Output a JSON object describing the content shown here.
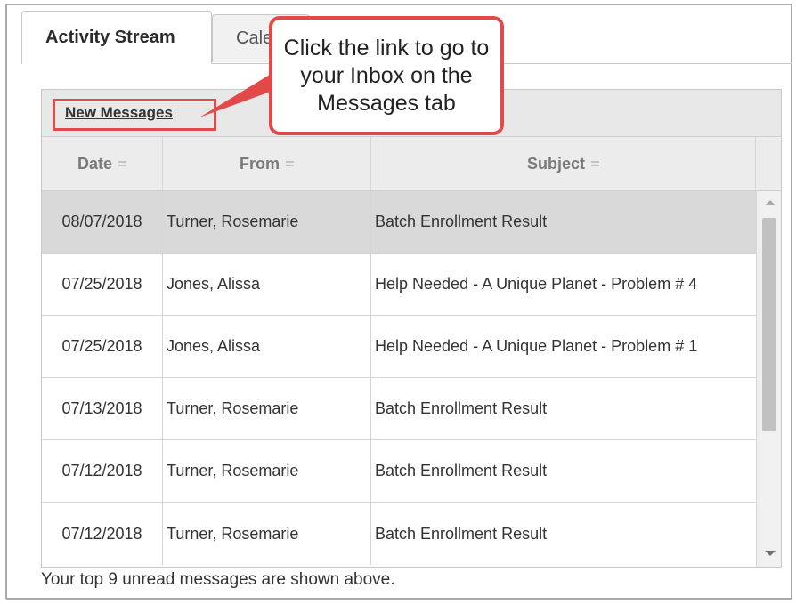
{
  "tabs": [
    {
      "label": "Activity Stream",
      "active": true
    },
    {
      "label": "Cale",
      "active": false
    }
  ],
  "panel": {
    "link_label": "New Messages",
    "columns": [
      {
        "label": "Date"
      },
      {
        "label": "From"
      },
      {
        "label": "Subject"
      }
    ],
    "rows": [
      {
        "date": "08/07/2018",
        "from": "Turner, Rosemarie",
        "subject": "Batch Enrollment Result",
        "selected": true
      },
      {
        "date": "07/25/2018",
        "from": "Jones, Alissa",
        "subject": "Help Needed - A Unique Planet - Problem # 4"
      },
      {
        "date": "07/25/2018",
        "from": "Jones, Alissa",
        "subject": "Help Needed - A Unique Planet - Problem # 1"
      },
      {
        "date": "07/13/2018",
        "from": "Turner, Rosemarie",
        "subject": "Batch Enrollment Result"
      },
      {
        "date": "07/12/2018",
        "from": "Turner, Rosemarie",
        "subject": "Batch Enrollment Result"
      },
      {
        "date": "07/12/2018",
        "from": "Turner, Rosemarie",
        "subject": "Batch Enrollment Result"
      }
    ],
    "footer": "Your top 9 unread messages are shown above."
  },
  "callout": {
    "text": "Click the link to go to your Inbox on the Messages tab"
  },
  "colors": {
    "callout_border": "#e34948",
    "header_bg": "#e8e8e8",
    "selected_row": "#d9d9d9"
  },
  "icons": [
    "sort-icon",
    "scroll-up-arrow-icon",
    "scroll-down-arrow-icon"
  ]
}
